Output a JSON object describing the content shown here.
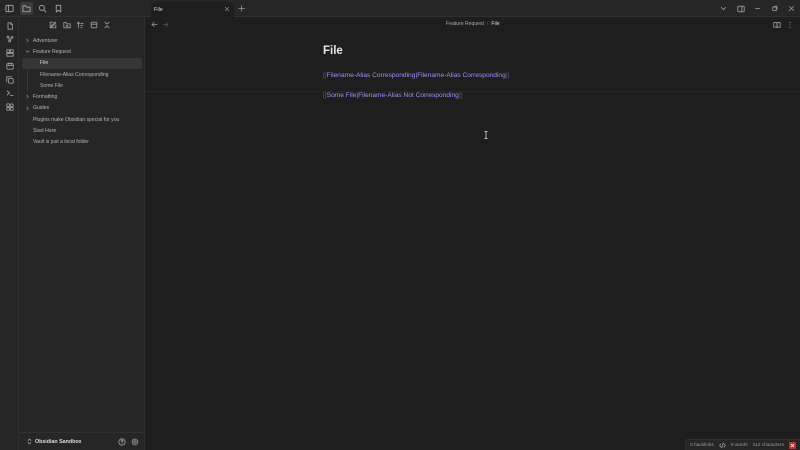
{
  "titlebar": {
    "tab_title": "File",
    "icons": [
      "sidebar-toggle-icon",
      "folder-icon",
      "search-icon",
      "bookmark-icon",
      "new-tab-icon",
      "chevron-down-icon",
      "layout-icon",
      "minimize-icon",
      "maximize-icon",
      "close-icon"
    ]
  },
  "ribbon": {
    "icons": [
      "file-icon",
      "graph-icon",
      "canvas-icon",
      "calendar-icon",
      "copy-icon",
      "terminal-icon",
      "plugins-icon"
    ]
  },
  "sidebar": {
    "actions": [
      "new-note-icon",
      "new-folder-icon",
      "sort-icon",
      "collapse-icon",
      "close-all-icon"
    ],
    "tree": [
      {
        "label": "Adventurer",
        "type": "folder",
        "expanded": false
      },
      {
        "label": "Feature Request",
        "type": "folder",
        "expanded": true
      },
      {
        "label": "File",
        "type": "file",
        "nested": true,
        "active": true
      },
      {
        "label": "Filename-Alias Corresponding",
        "type": "file",
        "nested": true
      },
      {
        "label": "Some File",
        "type": "file",
        "nested": true
      },
      {
        "label": "Formatting",
        "type": "folder",
        "expanded": false
      },
      {
        "label": "Guides",
        "type": "folder",
        "expanded": false
      },
      {
        "label": "Plugins make Obsidian special for you",
        "type": "file"
      },
      {
        "label": "Start Here",
        "type": "file"
      },
      {
        "label": "Vault is just a local folder",
        "type": "file"
      }
    ],
    "vault_name": "Obsidian Sandbox"
  },
  "header": {
    "breadcrumb_parent": "Feature Request",
    "breadcrumb_sep": "/",
    "breadcrumb_current": "File"
  },
  "note": {
    "title": "File",
    "link1_open": "[[",
    "link1_text": "Filename-Alias Corresponding|Filename-Alias Corresponding",
    "link1_close": "]]",
    "link2_open": "[[",
    "link2_text": "Some File|Filename-Alias Not Corresponding",
    "link2_close": "]]"
  },
  "status": {
    "backlinks": "0 backlinks",
    "words": "9 words",
    "characters": "112 characters"
  },
  "colors": {
    "link": "#a88bfa",
    "background": "#1e1e1e",
    "sidebar": "#262626",
    "sync_error": "#b13434"
  }
}
